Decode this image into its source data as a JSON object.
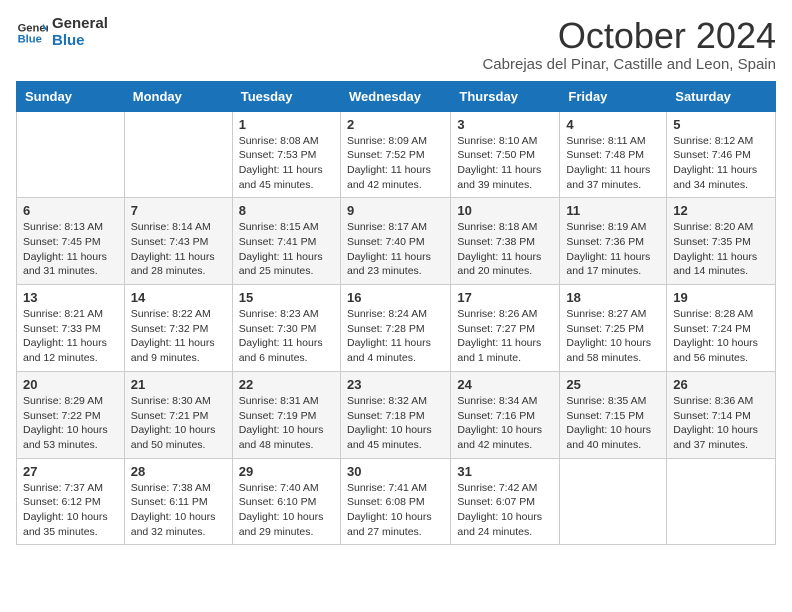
{
  "header": {
    "logo_line1": "General",
    "logo_line2": "Blue",
    "month": "October 2024",
    "location": "Cabrejas del Pinar, Castille and Leon, Spain"
  },
  "days_of_week": [
    "Sunday",
    "Monday",
    "Tuesday",
    "Wednesday",
    "Thursday",
    "Friday",
    "Saturday"
  ],
  "weeks": [
    [
      {
        "day": "",
        "info": ""
      },
      {
        "day": "",
        "info": ""
      },
      {
        "day": "1",
        "info": "Sunrise: 8:08 AM\nSunset: 7:53 PM\nDaylight: 11 hours and 45 minutes."
      },
      {
        "day": "2",
        "info": "Sunrise: 8:09 AM\nSunset: 7:52 PM\nDaylight: 11 hours and 42 minutes."
      },
      {
        "day": "3",
        "info": "Sunrise: 8:10 AM\nSunset: 7:50 PM\nDaylight: 11 hours and 39 minutes."
      },
      {
        "day": "4",
        "info": "Sunrise: 8:11 AM\nSunset: 7:48 PM\nDaylight: 11 hours and 37 minutes."
      },
      {
        "day": "5",
        "info": "Sunrise: 8:12 AM\nSunset: 7:46 PM\nDaylight: 11 hours and 34 minutes."
      }
    ],
    [
      {
        "day": "6",
        "info": "Sunrise: 8:13 AM\nSunset: 7:45 PM\nDaylight: 11 hours and 31 minutes."
      },
      {
        "day": "7",
        "info": "Sunrise: 8:14 AM\nSunset: 7:43 PM\nDaylight: 11 hours and 28 minutes."
      },
      {
        "day": "8",
        "info": "Sunrise: 8:15 AM\nSunset: 7:41 PM\nDaylight: 11 hours and 25 minutes."
      },
      {
        "day": "9",
        "info": "Sunrise: 8:17 AM\nSunset: 7:40 PM\nDaylight: 11 hours and 23 minutes."
      },
      {
        "day": "10",
        "info": "Sunrise: 8:18 AM\nSunset: 7:38 PM\nDaylight: 11 hours and 20 minutes."
      },
      {
        "day": "11",
        "info": "Sunrise: 8:19 AM\nSunset: 7:36 PM\nDaylight: 11 hours and 17 minutes."
      },
      {
        "day": "12",
        "info": "Sunrise: 8:20 AM\nSunset: 7:35 PM\nDaylight: 11 hours and 14 minutes."
      }
    ],
    [
      {
        "day": "13",
        "info": "Sunrise: 8:21 AM\nSunset: 7:33 PM\nDaylight: 11 hours and 12 minutes."
      },
      {
        "day": "14",
        "info": "Sunrise: 8:22 AM\nSunset: 7:32 PM\nDaylight: 11 hours and 9 minutes."
      },
      {
        "day": "15",
        "info": "Sunrise: 8:23 AM\nSunset: 7:30 PM\nDaylight: 11 hours and 6 minutes."
      },
      {
        "day": "16",
        "info": "Sunrise: 8:24 AM\nSunset: 7:28 PM\nDaylight: 11 hours and 4 minutes."
      },
      {
        "day": "17",
        "info": "Sunrise: 8:26 AM\nSunset: 7:27 PM\nDaylight: 11 hours and 1 minute."
      },
      {
        "day": "18",
        "info": "Sunrise: 8:27 AM\nSunset: 7:25 PM\nDaylight: 10 hours and 58 minutes."
      },
      {
        "day": "19",
        "info": "Sunrise: 8:28 AM\nSunset: 7:24 PM\nDaylight: 10 hours and 56 minutes."
      }
    ],
    [
      {
        "day": "20",
        "info": "Sunrise: 8:29 AM\nSunset: 7:22 PM\nDaylight: 10 hours and 53 minutes."
      },
      {
        "day": "21",
        "info": "Sunrise: 8:30 AM\nSunset: 7:21 PM\nDaylight: 10 hours and 50 minutes."
      },
      {
        "day": "22",
        "info": "Sunrise: 8:31 AM\nSunset: 7:19 PM\nDaylight: 10 hours and 48 minutes."
      },
      {
        "day": "23",
        "info": "Sunrise: 8:32 AM\nSunset: 7:18 PM\nDaylight: 10 hours and 45 minutes."
      },
      {
        "day": "24",
        "info": "Sunrise: 8:34 AM\nSunset: 7:16 PM\nDaylight: 10 hours and 42 minutes."
      },
      {
        "day": "25",
        "info": "Sunrise: 8:35 AM\nSunset: 7:15 PM\nDaylight: 10 hours and 40 minutes."
      },
      {
        "day": "26",
        "info": "Sunrise: 8:36 AM\nSunset: 7:14 PM\nDaylight: 10 hours and 37 minutes."
      }
    ],
    [
      {
        "day": "27",
        "info": "Sunrise: 7:37 AM\nSunset: 6:12 PM\nDaylight: 10 hours and 35 minutes."
      },
      {
        "day": "28",
        "info": "Sunrise: 7:38 AM\nSunset: 6:11 PM\nDaylight: 10 hours and 32 minutes."
      },
      {
        "day": "29",
        "info": "Sunrise: 7:40 AM\nSunset: 6:10 PM\nDaylight: 10 hours and 29 minutes."
      },
      {
        "day": "30",
        "info": "Sunrise: 7:41 AM\nSunset: 6:08 PM\nDaylight: 10 hours and 27 minutes."
      },
      {
        "day": "31",
        "info": "Sunrise: 7:42 AM\nSunset: 6:07 PM\nDaylight: 10 hours and 24 minutes."
      },
      {
        "day": "",
        "info": ""
      },
      {
        "day": "",
        "info": ""
      }
    ]
  ]
}
